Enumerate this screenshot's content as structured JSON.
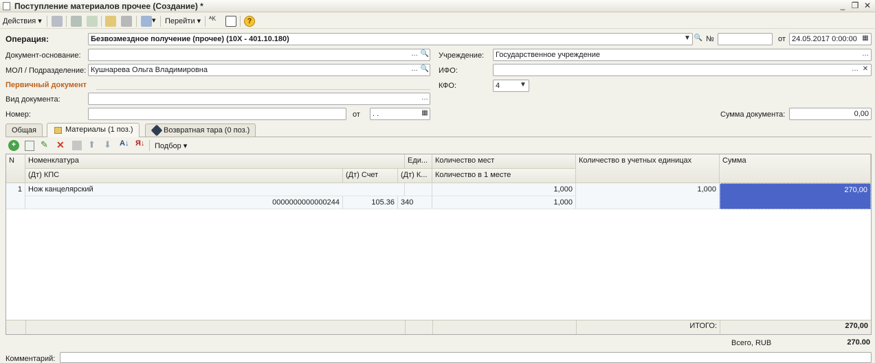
{
  "window": {
    "title": "Поступление материалов прочее (Создание) *",
    "min": "_",
    "restore": "❐",
    "close": "✕"
  },
  "toolbar": {
    "actions": "Действия ▾",
    "goto": "Перейти ▾",
    "help": "?"
  },
  "header": {
    "operation_label": "Операция:",
    "operation_value": "Безвозмездное получение (прочее) (10X - 401.10.180)",
    "number_label": "№",
    "number_value": "",
    "date_label": "от",
    "date_value": "24.05.2017  0:00:00",
    "basis_label": "Документ-основание:",
    "basis_value": "",
    "mol_label": "МОЛ / Подразделение:",
    "mol_value": "Кушнарева Ольга Владимировна",
    "institution_label": "Учреждение:",
    "institution_value": "Государственное учреждение",
    "ifo_label": "ИФО:",
    "ifo_value": "",
    "kfo_label": "КФО:",
    "kfo_value": "4",
    "primary_doc_title": "Первичный документ",
    "doc_type_label": "Вид документа:",
    "doc_type_value": "",
    "num_label": "Номер:",
    "num_value": "",
    "num_date_label": "от",
    "num_date_value": " .  .",
    "sum_label": "Сумма документа:",
    "sum_value": "0,00"
  },
  "tabs": [
    {
      "label": "Общая"
    },
    {
      "label": "Материалы (1 поз.)"
    },
    {
      "label": "Возвратная тара (0 поз.)"
    }
  ],
  "grid_toolbar": {
    "pick": "Подбор ▾"
  },
  "columns": {
    "n": "N",
    "nom": "Номенклатура",
    "unit": "Еди...",
    "qty_places": "Количество мест",
    "qty_units": "Количество в учетных единицах",
    "sum": "Сумма",
    "kps": "(Дт) КПС",
    "acc": "(Дт) Счет",
    "k": "(Дт) К...",
    "qty_one": "Количество в 1 месте"
  },
  "rows": [
    {
      "n": "1",
      "nom": "Нож канцелярский",
      "unit": "",
      "qty_places": "1,000",
      "qty_units": "1,000",
      "sum": "270,00",
      "kps": "0000000000000244",
      "acc": "105.36",
      "k": "340",
      "qty_one": "1,000"
    }
  ],
  "totals": {
    "label": "ИТОГО:",
    "sum": "270,00",
    "all_label": "Всего, RUB",
    "all_value": "270.00"
  },
  "comment": {
    "label": "Комментарий:",
    "value": ""
  },
  "colors": {
    "selection": "#4a64c8",
    "section": "#c0621a"
  }
}
